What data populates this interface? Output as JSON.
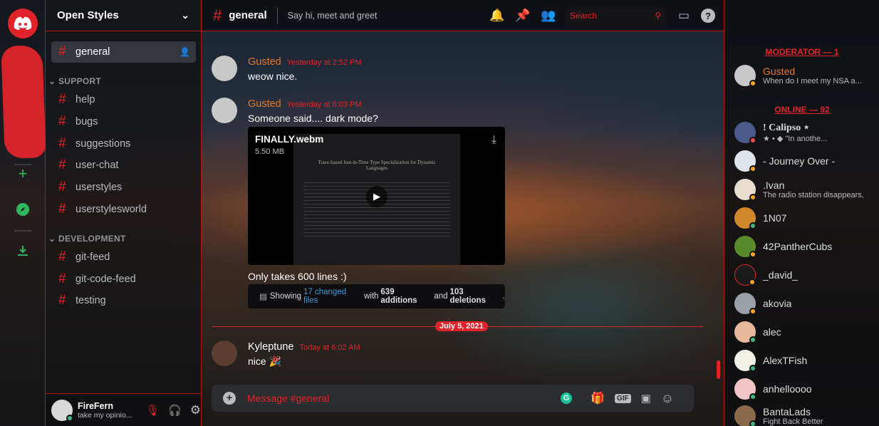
{
  "server": {
    "name": "Open Styles"
  },
  "channels": {
    "top": [
      {
        "label": "general"
      }
    ],
    "support": {
      "label": "SUPPORT",
      "items": [
        "help",
        "bugs",
        "suggestions",
        "user-chat",
        "userstyles",
        "userstylesworld"
      ]
    },
    "development": {
      "label": "DEVELOPMENT",
      "items": [
        "git-feed",
        "git-code-feed",
        "testing"
      ]
    }
  },
  "user": {
    "name": "FireFern",
    "status": "take my opinio..."
  },
  "header": {
    "channel": "general",
    "topic": "Say hi, meet and greet",
    "search_placeholder": "Search"
  },
  "messages": [
    {
      "author": "Gusted",
      "timestamp": "Yesterday at 2:52 PM",
      "text": "weow nice."
    },
    {
      "author": "Gusted",
      "timestamp": "Yesterday at 6:03 PM",
      "text": "Someone said.... dark mode?"
    },
    {
      "text": "Only takes 600 lines :)"
    },
    {
      "author": "Kyleptune",
      "timestamp": "Today at 6:02 AM",
      "text": "nice"
    }
  ],
  "attachment": {
    "filename": "FINALLY.webm",
    "size": "5.50 MB",
    "paper_title": "Trace-based Just-in-Time Type Specialization for Dynamic Languages"
  },
  "github": {
    "pre": "Showing",
    "files": "17 changed files",
    "with": "with",
    "additions": "639 additions",
    "and": "and",
    "deletions": "103 deletions",
    "end": "."
  },
  "date_divider": "July 5, 2021",
  "composer": {
    "placeholder": "Message #general",
    "gif": "GIF"
  },
  "members": {
    "moderator_header": "MODERATOR — 1",
    "moderators": [
      {
        "name": "Gusted",
        "sub": "When do I meet my NSA a...",
        "status": "#faa61a"
      }
    ],
    "online_header": "ONLINE — 92",
    "online": [
      {
        "name": "! Calipso ⋆",
        "sub": "★ • ◆ \"In anothe...",
        "status": "#f04747"
      },
      {
        "name": "- Journey Over -",
        "sub": "",
        "status": "#faa61a"
      },
      {
        "name": ".Ivan",
        "sub": "The radio station disappears, ...",
        "status": "#faa61a"
      },
      {
        "name": "1N07",
        "sub": "",
        "status": "#43b581"
      },
      {
        "name": "42PantherCubs",
        "sub": "",
        "status": "#faa61a"
      },
      {
        "name": "_david_",
        "sub": "",
        "status": "#faa61a"
      },
      {
        "name": "akovia",
        "sub": "",
        "status": "#faa61a"
      },
      {
        "name": "alec",
        "sub": "",
        "status": "#43b581"
      },
      {
        "name": "AlexTFish",
        "sub": "",
        "status": "#43b581"
      },
      {
        "name": "anhelloooo",
        "sub": "",
        "status": "#43b581"
      },
      {
        "name": "BantaLads",
        "sub": "Fight Back Better",
        "status": "#43b581"
      }
    ]
  },
  "colors": {
    "accent": "#e0232a",
    "author": "#e07a2e",
    "link": "#3a9dde"
  }
}
